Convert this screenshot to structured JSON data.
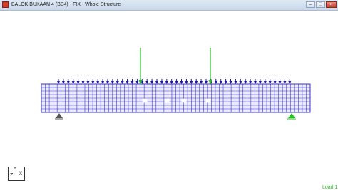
{
  "window": {
    "title": "BALOK BUKAAN 4 (BB4) - FIX - Whole Structure",
    "controls": {
      "minimize": "–",
      "maximize": "□",
      "close": "×"
    }
  },
  "viewport": {
    "load_label": "Load 1",
    "axis": {
      "y": "Y",
      "z": "Z",
      "x": "X"
    },
    "colors": {
      "mesh": "#3a36c8",
      "mesh_fill": "#ecebff",
      "point_load": "#22c21e",
      "distributed_load": "#1d1aa6",
      "pin_support": "#555555",
      "roller_support": "#22c21e"
    }
  }
}
